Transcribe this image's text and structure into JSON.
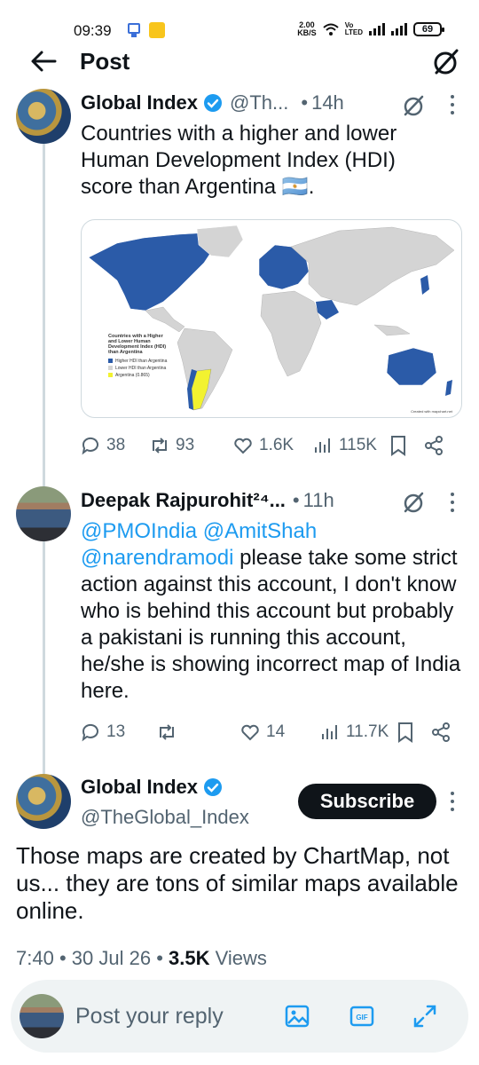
{
  "status_bar": {
    "time": "09:39",
    "speed_value": "2.00",
    "speed_unit": "KB/S",
    "network_label_1": "Vo",
    "network_label_2": "LTED",
    "battery": "69"
  },
  "header": {
    "title": "Post"
  },
  "tweet1": {
    "name": "Global Index",
    "handle": "@Th...",
    "separator": "•",
    "time_ago": "14h",
    "text": "Countries with a higher and lower Human Development Index (HDI) score than Argentina 🇦🇷.",
    "map": {
      "legend_title": "Countries with a Higher and Lower Human Development Index (HDI) than Argentina",
      "legend_items": [
        "Higher HDI than Argentina",
        "Lower HDI than Argentina",
        "Argentina (0.865)"
      ],
      "credit": "Created with mapchart.net",
      "colors": {
        "higher": "#2b5ba8",
        "lower": "#d4d4d4",
        "argentina": "#f2f230"
      }
    },
    "replies": "38",
    "reposts": "93",
    "likes": "1.6K",
    "views": "115K"
  },
  "tweet2": {
    "name": "Deepak Rajpurohit²⁴...",
    "separator": "•",
    "time_ago": "11h",
    "mention1": "@PMOIndia",
    "mention2": "@AmitShah",
    "mention3": "@narendramodi",
    "text": " please take some strict action against this account, I don't know who is behind this account but probably a pakistani is running this account, he/she is showing incorrect map of India here.",
    "replies": "13",
    "likes": "14",
    "views": "11.7K"
  },
  "main_tweet": {
    "name": "Global Index",
    "handle": "@TheGlobal_Index",
    "subscribe_label": "Subscribe",
    "text": "Those maps are created by ChartMap, not us... they are tons of similar maps available online.",
    "time": "7:40",
    "date": "30 Jul 26",
    "views_count": "3.5K",
    "views_label": "Views",
    "sep": "•"
  },
  "reply_bar": {
    "placeholder": "Post your reply"
  },
  "colors": {
    "accent": "#1d9bf0",
    "text": "#0f1419",
    "muted": "#536471"
  }
}
